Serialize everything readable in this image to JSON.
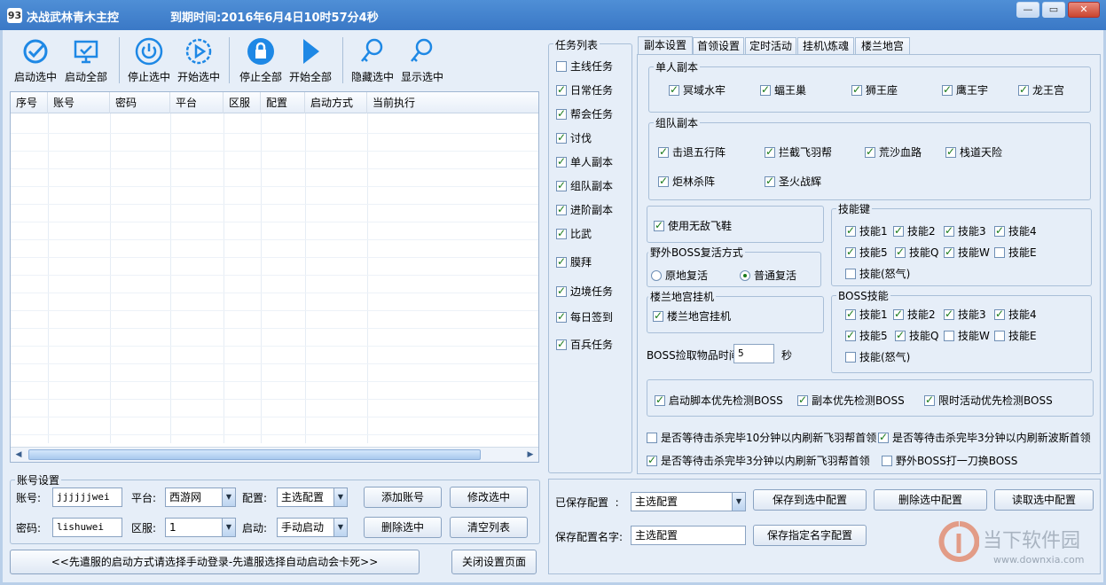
{
  "window": {
    "title": "决战武林青木主控",
    "expire": "到期时间:2016年6月4日10时57分4秒",
    "app_icon_text": "93",
    "min": "—",
    "restore": "▭",
    "close": "✕"
  },
  "toolbar": [
    {
      "name": "start-selected",
      "label": "启动选中",
      "icon": "checkmark-badge-icon"
    },
    {
      "name": "start-all",
      "label": "启动全部",
      "icon": "monitor-check-icon"
    },
    {
      "name": "stop-selected",
      "label": "停止选中",
      "icon": "power-icon"
    },
    {
      "name": "begin-selected",
      "label": "开始选中",
      "icon": "play-gear-icon"
    },
    {
      "name": "stop-all",
      "label": "停止全部",
      "icon": "lock-icon"
    },
    {
      "name": "begin-all",
      "label": "开始全部",
      "icon": "play-icon"
    },
    {
      "name": "hide-selected",
      "label": "隐藏选中",
      "icon": "key-search-icon"
    },
    {
      "name": "show-selected",
      "label": "显示选中",
      "icon": "key-search-icon"
    }
  ],
  "grid": {
    "columns": [
      "序号",
      "账号",
      "密码",
      "平台",
      "区服",
      "配置",
      "启动方式",
      "当前执行"
    ]
  },
  "account": {
    "group_title": "账号设置",
    "account_label": "账号:",
    "account_value": "jjjjjjwei",
    "password_label": "密码:",
    "password_value": "lishuwei",
    "platform_label": "平台:",
    "platform_value": "西游网",
    "server_label": "区服:",
    "server_value": "1",
    "config_label": "配置:",
    "config_value": "主选配置",
    "launch_label": "启动:",
    "launch_value": "手动启动",
    "add_btn": "添加账号",
    "modify_btn": "修改选中",
    "delete_btn": "删除选中",
    "clear_btn": "清空列表",
    "notice_btn": "<<先遣服的启动方式请选择手动登录-先遣服选择自动启动会卡死>>",
    "close_btn": "关闭设置页面"
  },
  "tasks": {
    "title": "任务列表",
    "items": [
      {
        "label": "主线任务",
        "checked": false
      },
      {
        "label": "日常任务",
        "checked": true
      },
      {
        "label": "帮会任务",
        "checked": true
      },
      {
        "label": "讨伐",
        "checked": true
      },
      {
        "label": "单人副本",
        "checked": true
      },
      {
        "label": "组队副本",
        "checked": true
      },
      {
        "label": "进阶副本",
        "checked": true
      },
      {
        "label": "比武",
        "checked": true
      },
      {
        "label": "膜拜",
        "checked": true
      },
      {
        "label": "边境任务",
        "checked": true
      },
      {
        "label": "每日签到",
        "checked": true
      },
      {
        "label": "百兵任务",
        "checked": true
      }
    ]
  },
  "tabs": [
    "副本设置",
    "首领设置",
    "定时活动",
    "挂机\\炼魂",
    "楼兰地宫"
  ],
  "single": {
    "title": "单人副本",
    "items": [
      "冥域水牢",
      "蝠王巢",
      "狮王座",
      "鹰王宇",
      "龙王宫"
    ]
  },
  "team": {
    "title": "组队副本",
    "items": [
      "击退五行阵",
      "拦截飞羽帮",
      "荒沙血路",
      "栈道天险",
      "炬林杀阵",
      "圣火战辉"
    ]
  },
  "nofly": {
    "label": "使用无敌飞鞋"
  },
  "revive": {
    "title": "野外BOSS复活方式",
    "opt1": "原地复活",
    "opt2": "普通复活"
  },
  "loulan": {
    "title": "楼兰地宫挂机",
    "label": "楼兰地宫挂机"
  },
  "pickup": {
    "label": "BOSS捡取物品时间",
    "value": "5",
    "unit": "秒"
  },
  "skills": {
    "title": "技能键",
    "items": [
      {
        "label": "技能1",
        "checked": true
      },
      {
        "label": "技能2",
        "checked": true
      },
      {
        "label": "技能3",
        "checked": true
      },
      {
        "label": "技能4",
        "checked": true
      },
      {
        "label": "技能5",
        "checked": true
      },
      {
        "label": "技能Q",
        "checked": true
      },
      {
        "label": "技能W",
        "checked": true
      },
      {
        "label": "技能E",
        "checked": false
      },
      {
        "label": "技能(怒气)",
        "checked": false
      }
    ]
  },
  "boss_skills": {
    "title": "BOSS技能",
    "items": [
      {
        "label": "技能1",
        "checked": true
      },
      {
        "label": "技能2",
        "checked": true
      },
      {
        "label": "技能3",
        "checked": true
      },
      {
        "label": "技能4",
        "checked": true
      },
      {
        "label": "技能5",
        "checked": true
      },
      {
        "label": "技能Q",
        "checked": true
      },
      {
        "label": "技能W",
        "checked": false
      },
      {
        "label": "技能E",
        "checked": false
      },
      {
        "label": "技能(怒气)",
        "checked": false
      }
    ]
  },
  "priority": {
    "items": [
      "启动脚本优先检测BOSS",
      "副本优先检测BOSS",
      "限时活动优先检测BOSS"
    ]
  },
  "waits": [
    {
      "label": "是否等待击杀完毕10分钟以内刷新飞羽帮首领",
      "checked": false
    },
    {
      "label": "是否等待击杀完毕3分钟以内刷新波斯首领",
      "checked": true
    },
    {
      "label": "是否等待击杀完毕3分钟以内刷新飞羽帮首领",
      "checked": true
    },
    {
      "label": "野外BOSS打一刀换BOSS",
      "checked": false
    }
  ],
  "config": {
    "saved_label": "已保存配置  :",
    "saved_value": "主选配置",
    "save_to_btn": "保存到选中配置",
    "delete_btn": "删除选中配置",
    "read_btn": "读取选中配置",
    "name_label": "保存配置名字:",
    "name_value": "主选配置",
    "save_named_btn": "保存指定名字配置"
  },
  "watermark": {
    "text": "当下软件园",
    "url": "www.downxia.com"
  }
}
